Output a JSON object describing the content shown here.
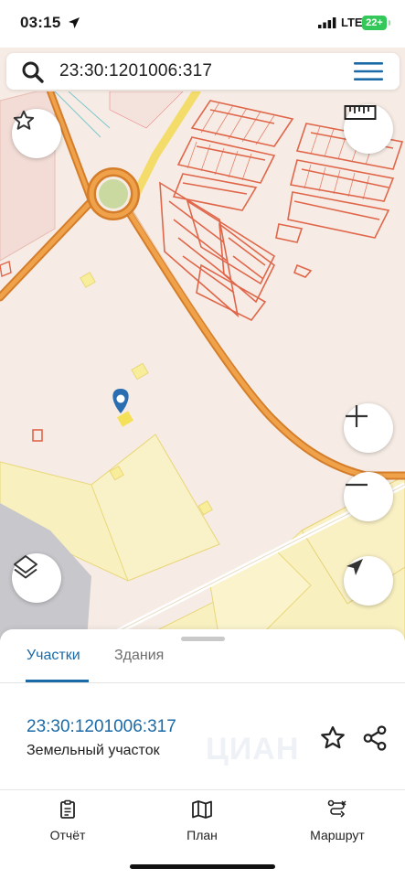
{
  "status_bar": {
    "time": "03:15",
    "network": "LTE",
    "battery": "22+"
  },
  "search": {
    "query": "23:30:1201006:317"
  },
  "map": {
    "buttons": [
      "favorite-star",
      "ruler",
      "zoom-in",
      "zoom-out",
      "layers",
      "my-location"
    ]
  },
  "sheet": {
    "tabs": [
      {
        "label": "Участки",
        "active": true
      },
      {
        "label": "Здания",
        "active": false
      }
    ],
    "result": {
      "cadastral_number": "23:30:1201006:317",
      "type": "Земельный участок"
    },
    "watermark": "ЦИАН"
  },
  "bottom_nav": {
    "items": [
      {
        "label": "Отчёт",
        "icon": "report-icon"
      },
      {
        "label": "План",
        "icon": "map-icon"
      },
      {
        "label": "Маршрут",
        "icon": "route-icon"
      }
    ]
  },
  "colors": {
    "accent": "#1a6aa8",
    "road": "#e58a2b",
    "parcel_red": "#e0664a",
    "zone_yellow": "#f7eeb0",
    "marker": "#2a6db0"
  }
}
